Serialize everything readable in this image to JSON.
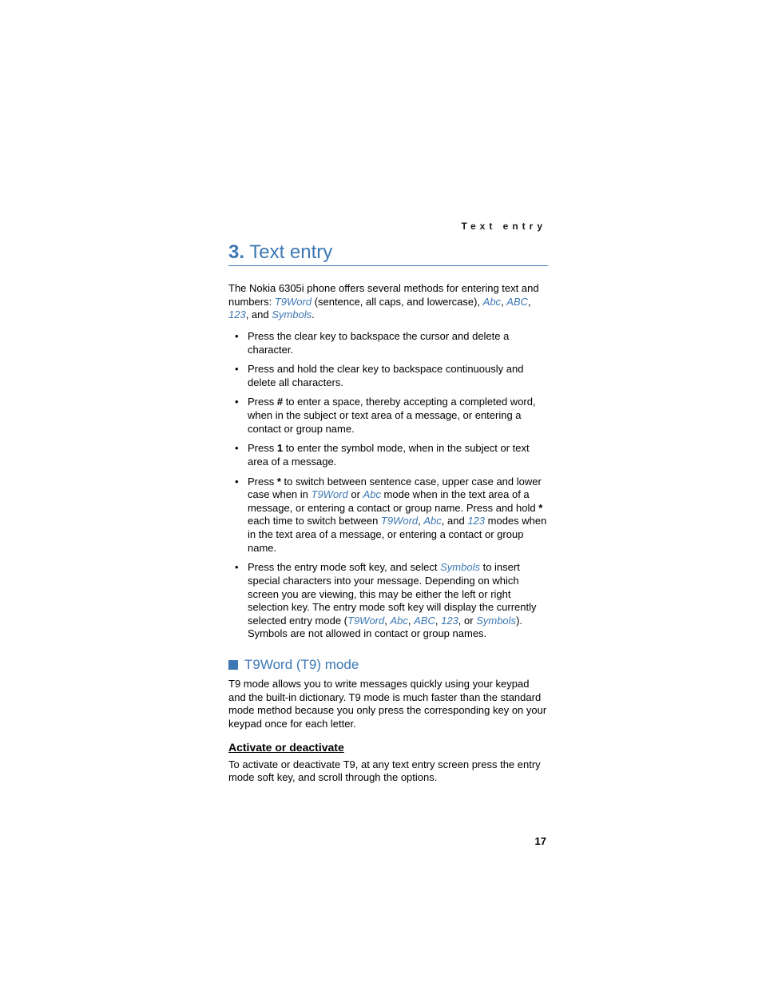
{
  "header": {
    "running": "Text entry"
  },
  "chapter": {
    "num": "3.",
    "title": "Text entry"
  },
  "intro": {
    "lead": "The Nokia 6305i phone offers several methods for entering text and numbers: ",
    "t9word": "T9Word",
    "after_t9": " (sentence, all caps, and lowercase), ",
    "abc_mixed": "Abc",
    "sep1": ", ",
    "abc_caps": "ABC",
    "sep2": ", ",
    "num_mode": "123",
    "sep3": ", and ",
    "symbols": "Symbols",
    "period": "."
  },
  "bullets": {
    "b1": "Press the clear key to backspace the cursor and delete a character.",
    "b2": "Press and hold the clear key to backspace continuously and delete all characters.",
    "b3": {
      "pre": "Press ",
      "hash": "#",
      "post": " to enter a space, thereby accepting a completed word, when in the subject or text area of a message, or entering a contact or group name."
    },
    "b4": {
      "pre": "Press ",
      "one": "1",
      "post": " to enter the symbol mode, when in the subject or text area of a message."
    },
    "b5": {
      "pre": "Press ",
      "star1": "*",
      "mid1": " to switch between sentence case, upper case and lower case when in ",
      "t9": "T9Word",
      "or": " or ",
      "abc": "Abc",
      "mid2": " mode when in the text area of a message, or entering a contact or group name. Press and hold ",
      "star2": "*",
      "mid3": " each time to switch between ",
      "t9b": "T9Word",
      "sep1": ", ",
      "abcb": "Abc",
      "sep2": ", and ",
      "num": "123",
      "post": " modes when in the text area of a message, or entering a contact or group name."
    },
    "b6": {
      "pre": "Press the entry mode soft key, and select ",
      "sym": "Symbols",
      "mid": " to insert special characters into your message. Depending on which screen you are viewing, this may be either the left or right selection key. The entry mode soft key will display the currently selected entry mode (",
      "t9": "T9Word",
      "s1": ", ",
      "abc": "Abc",
      "s2": ", ",
      "abcC": "ABC",
      "s3": ", ",
      "num": "123",
      "s4": ", or ",
      "sym2": "Symbols",
      "post": "). Symbols are not allowed in contact or group names."
    }
  },
  "section": {
    "title": "T9Word (T9) mode",
    "para": "T9 mode allows you to write messages quickly using your keypad and the built-in dictionary. T9 mode is much faster than the standard mode method because you only press the corresponding key on your keypad once for each letter."
  },
  "sub": {
    "title": "Activate or deactivate",
    "para": "To activate or deactivate T9, at any text entry screen press the entry mode soft key, and scroll through the options."
  },
  "page": {
    "num": "17"
  }
}
